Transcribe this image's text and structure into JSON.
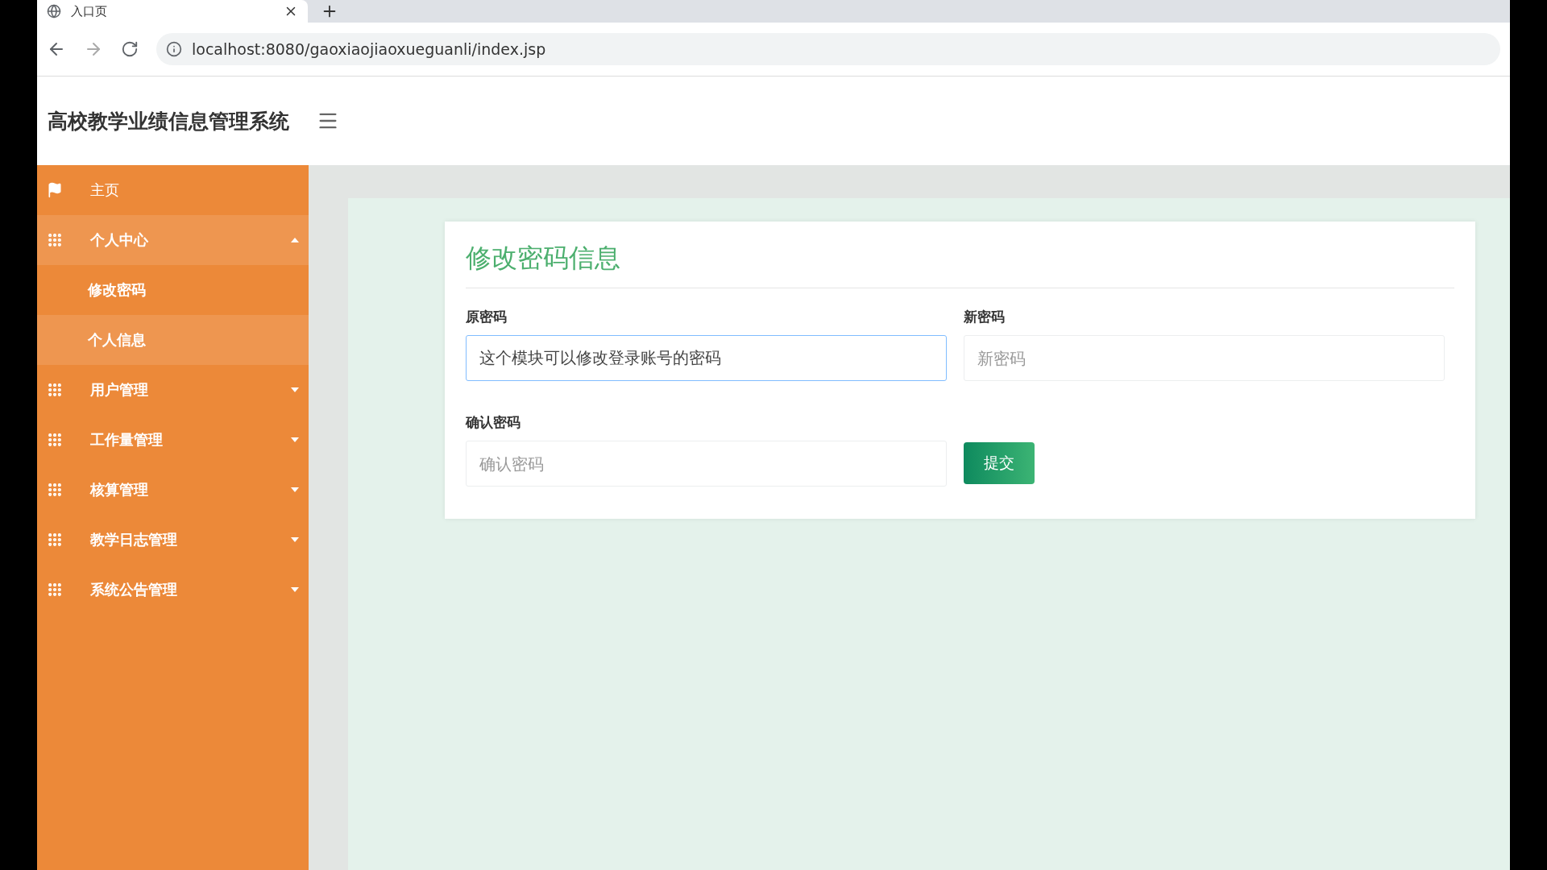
{
  "browser": {
    "tab_title": "入口页",
    "address": "localhost:8080/gaoxiaojiaoxueguanli/index.jsp"
  },
  "header": {
    "title": "高校教学业绩信息管理系统"
  },
  "sidebar": {
    "items": [
      {
        "kind": "link",
        "label": "主页",
        "highlighted": false
      },
      {
        "kind": "group",
        "label": "个人中心",
        "expanded": true,
        "highlighted": true,
        "children": [
          {
            "label": "修改密码",
            "highlighted": false
          },
          {
            "label": "个人信息",
            "highlighted": true
          }
        ]
      },
      {
        "kind": "group",
        "label": "用户管理",
        "expanded": false,
        "highlighted": false
      },
      {
        "kind": "group",
        "label": "工作量管理",
        "expanded": false,
        "highlighted": false
      },
      {
        "kind": "group",
        "label": "核算管理",
        "expanded": false,
        "highlighted": false
      },
      {
        "kind": "group",
        "label": "教学日志管理",
        "expanded": false,
        "highlighted": false
      },
      {
        "kind": "group",
        "label": "系统公告管理",
        "expanded": false,
        "highlighted": false
      }
    ]
  },
  "form": {
    "title": "修改密码信息",
    "fields": [
      {
        "label": "原密码",
        "value": "这个模块可以修改登录账号的密码",
        "focused": true
      },
      {
        "label": "新密码",
        "placeholder": "新密码",
        "focused": false
      },
      {
        "label": "确认密码",
        "placeholder": "确认密码",
        "focused": false
      }
    ],
    "submit": "提交"
  }
}
